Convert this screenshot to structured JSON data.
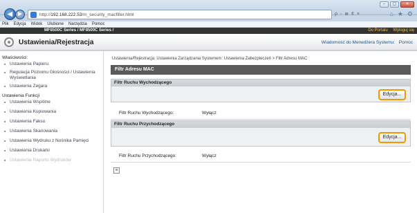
{
  "browser": {
    "url_prefix": "http://",
    "url_host": "192.168.222.53",
    "url_path": "/m_security_macfilter.html",
    "address_tools": "ρ - ≣ ¢ ×",
    "menu": [
      "Plik",
      "Edycja",
      "Widok",
      "Ulubione",
      "Narzędzia",
      "Pomoc"
    ],
    "window_buttons": [
      "–",
      "▢",
      "✕"
    ]
  },
  "app": {
    "model_bar": "MF8500C Series / MF8500C Series /",
    "top_links": [
      "Do Portalu",
      "Wyloguj się"
    ],
    "title": "Ustawienia/Rejestracja",
    "header_links": [
      "Wiadomość do Menedżera Systemu:",
      "Pomoc"
    ]
  },
  "sidebar": {
    "groups": [
      {
        "label": "Właściwości:",
        "items": [
          {
            "label": "Ustawienia Papieru",
            "dim": false
          },
          {
            "label": "Regulacja Poziomu Głośności / Ustawienia Wyświetlania",
            "dim": false
          },
          {
            "label": "Ustawienia Zegara",
            "dim": false
          }
        ]
      },
      {
        "label": "Ustawienia Funkcji",
        "items": [
          {
            "label": "Ustawienia Wspólne",
            "dim": false
          },
          {
            "label": "Ustawienia Kopiowania",
            "dim": false
          },
          {
            "label": "Ustawienia Faksu",
            "dim": false
          },
          {
            "label": "Ustawienia Skanowania",
            "dim": false
          },
          {
            "label": "Ustawienia Wydruku z Nośnika Pamięci",
            "dim": false
          },
          {
            "label": "Ustawienia Drukarki",
            "dim": false
          },
          {
            "label": "Ustawienia Raportu Wydruków",
            "dim": true
          }
        ]
      }
    ]
  },
  "main": {
    "breadcrumb": "Ustawienia/Rejestracja: Ustawienia Zarządzania Systemem: Ustawienia Zabezpieczeń > Filtr Adresu MAC",
    "page_title": "Filtr Adresu MAC",
    "sections": [
      {
        "title": "Filtr Ruchu Wychodzącego",
        "button": "Edycja...",
        "row_label": "Filtr Ruchu Wychodzącego:",
        "row_value": "Wyłącz"
      },
      {
        "title": "Filtr Ruchu Przychodzącego",
        "button": "Edycja...",
        "row_label": "Filtr Ruchu Przychodzącego:",
        "row_value": "Wyłącz"
      }
    ]
  }
}
